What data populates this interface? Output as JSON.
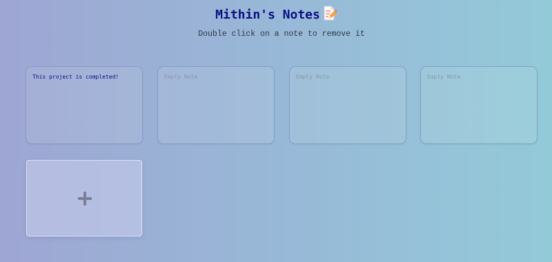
{
  "header": {
    "title": "Mithin's Notes",
    "title_icon": "memo-icon",
    "subtitle": "Double click on a note to remove it"
  },
  "notes": [
    {
      "value": "This project is completed!",
      "placeholder": "Empty Note"
    },
    {
      "value": "",
      "placeholder": "Empty Note"
    },
    {
      "value": "",
      "placeholder": "Empty Note"
    },
    {
      "value": "",
      "placeholder": "Empty Note"
    }
  ],
  "add_button": {
    "icon": "plus-icon"
  },
  "colors": {
    "title": "#0b0f85",
    "subtitle": "#2d3748",
    "note_text": "#0b0f85",
    "background_left": "#9ea6d3",
    "background_right": "#93cad8",
    "plus": "#7a7e96"
  }
}
